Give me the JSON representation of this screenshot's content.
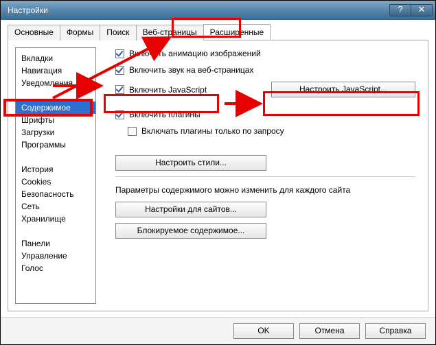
{
  "window": {
    "title": "Настройки"
  },
  "tabs": [
    "Основные",
    "Формы",
    "Поиск",
    "Веб-страницы",
    "Расширенные"
  ],
  "active_tab_index": 4,
  "sidebar": {
    "groups": [
      [
        "Вкладки",
        "Навигация",
        "Уведомления"
      ],
      [
        "Содержимое",
        "Шрифты",
        "Загрузки",
        "Программы"
      ],
      [
        "История",
        "Cookies",
        "Безопасность",
        "Сеть",
        "Хранилище"
      ],
      [
        "Панели",
        "Управление",
        "Голос"
      ]
    ],
    "selected": "Содержимое"
  },
  "content": {
    "chk_anim": "Включить анимацию изображений",
    "chk_sound": "Включить звук на веб-страницах",
    "chk_js": "Включить JavaScript",
    "btn_js": "Настроить JavaScript...",
    "chk_plugins": "Включить плагины",
    "chk_plugins_demand": "Включать плагины только по запросу",
    "btn_styles": "Настроить стили...",
    "para": "Параметры содержимого можно изменить для каждого сайта",
    "btn_sites": "Настройки для сайтов...",
    "btn_blocked": "Блокируемое содержимое..."
  },
  "footer": {
    "ok": "OK",
    "cancel": "Отмена",
    "help": "Справка"
  }
}
